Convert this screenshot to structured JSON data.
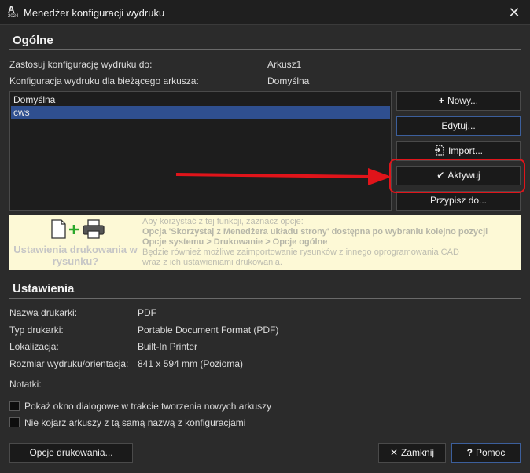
{
  "window": {
    "title": "Menedżer konfiguracji wydruku",
    "icon_symbol": "A",
    "icon_year": "2024"
  },
  "general": {
    "header": "Ogólne",
    "apply_label": "Zastosuj konfigurację wydruku do:",
    "apply_value": "Arkusz1",
    "current_label": "Konfiguracja wydruku dla bieżącego arkusza:",
    "current_value": "Domyślna",
    "configs": [
      "Domyślna",
      "cws"
    ],
    "selected_index": 1
  },
  "buttons": {
    "new": "Nowy...",
    "edit": "Edytuj...",
    "import": "Import...",
    "activate": "Aktywuj",
    "assign": "Przypisz do..."
  },
  "promo": {
    "question": "Ustawienia drukowania w rysunku?",
    "line1": "Aby korzystać z tej funkcji, zaznacz opcje:",
    "line2": "Opcja 'Skorzystaj z Menedżera układu strony' dostępna po wybraniu kolejno pozycji",
    "line3": "Opcje systemu > Drukowanie > Opcje ogólne",
    "line4": "Będzie również możliwe zaimportowanie rysunków z innego oprogramowania CAD",
    "line5": "wraz z ich ustawieniami drukowania."
  },
  "settings": {
    "header": "Ustawienia",
    "printer_name_label": "Nazwa drukarki:",
    "printer_name_value": "PDF",
    "printer_type_label": "Typ drukarki:",
    "printer_type_value": "Portable Document Format (PDF)",
    "location_label": "Lokalizacja:",
    "location_value": "Built-In Printer",
    "size_label": "Rozmiar wydruku/orientacja:",
    "size_value": "841 x 594 mm (Pozioma)",
    "notes_label": "Notatki:",
    "checkbox1": "Pokaż okno dialogowe w trakcie tworzenia nowych arkuszy",
    "checkbox2": "Nie kojarz arkuszy z tą samą nazwą z konfiguracjami",
    "checkbox1_checked": false,
    "checkbox2_checked": false
  },
  "footer": {
    "print_options": "Opcje drukowania...",
    "close": "Zamknij",
    "help": "Pomoc"
  },
  "colors": {
    "highlight": "#e0141a",
    "selection": "#2f4f8f",
    "promo_bg": "#fdf9d6"
  }
}
